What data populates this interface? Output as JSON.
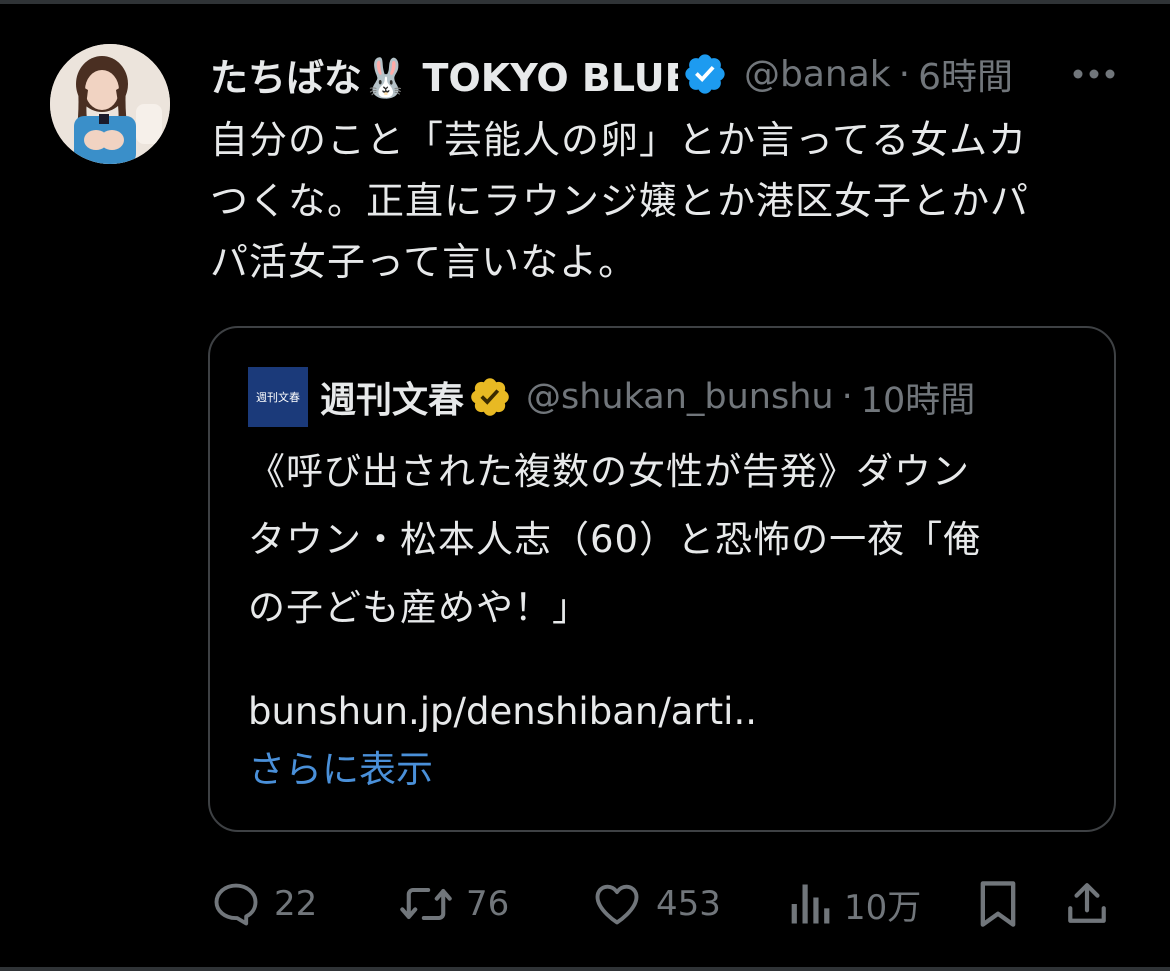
{
  "tweet": {
    "author": {
      "name": "たちばな🐰 TOKYO BLUE",
      "handle": "@banak",
      "verified": true,
      "badge_color": "#1d9bf0"
    },
    "separator": "·",
    "time": "6時間",
    "text": "自分のこと「芸能人の卵」とか言ってる女ムカ\nつくな。正直にラウンジ嬢とか港区女子とかパ\nパ活女子って言いなよ。",
    "more_icon": "more-horizontal-icon"
  },
  "quote": {
    "avatar_text": "週刊文春",
    "avatar_color": "#1b3a7a",
    "name": "週刊文春",
    "badge_color": "#e8b923",
    "handle": "@shukan_bunshu",
    "separator": "·",
    "time": "10時間",
    "text": "《呼び出された複数の女性が告発》ダウン\nタウン・松本人志（60）と恐怖の一夜「俺\nの子ども産めや！」",
    "link": "bunshun.jp/denshiban/arti..",
    "show_more": "さらに表示",
    "show_more_color": "#4a90d9"
  },
  "actions": {
    "reply": {
      "icon": "reply-icon",
      "count": "22"
    },
    "retweet": {
      "icon": "retweet-icon",
      "count": "76"
    },
    "like": {
      "icon": "heart-icon",
      "count": "453"
    },
    "views": {
      "icon": "views-bar-chart-icon",
      "count": "10万"
    },
    "bookmark": {
      "icon": "bookmark-icon"
    },
    "share": {
      "icon": "share-icon"
    }
  },
  "colors": {
    "background": "#000000",
    "text": "#e7e9ea",
    "secondary": "#71767b",
    "border": "#3e4144"
  }
}
